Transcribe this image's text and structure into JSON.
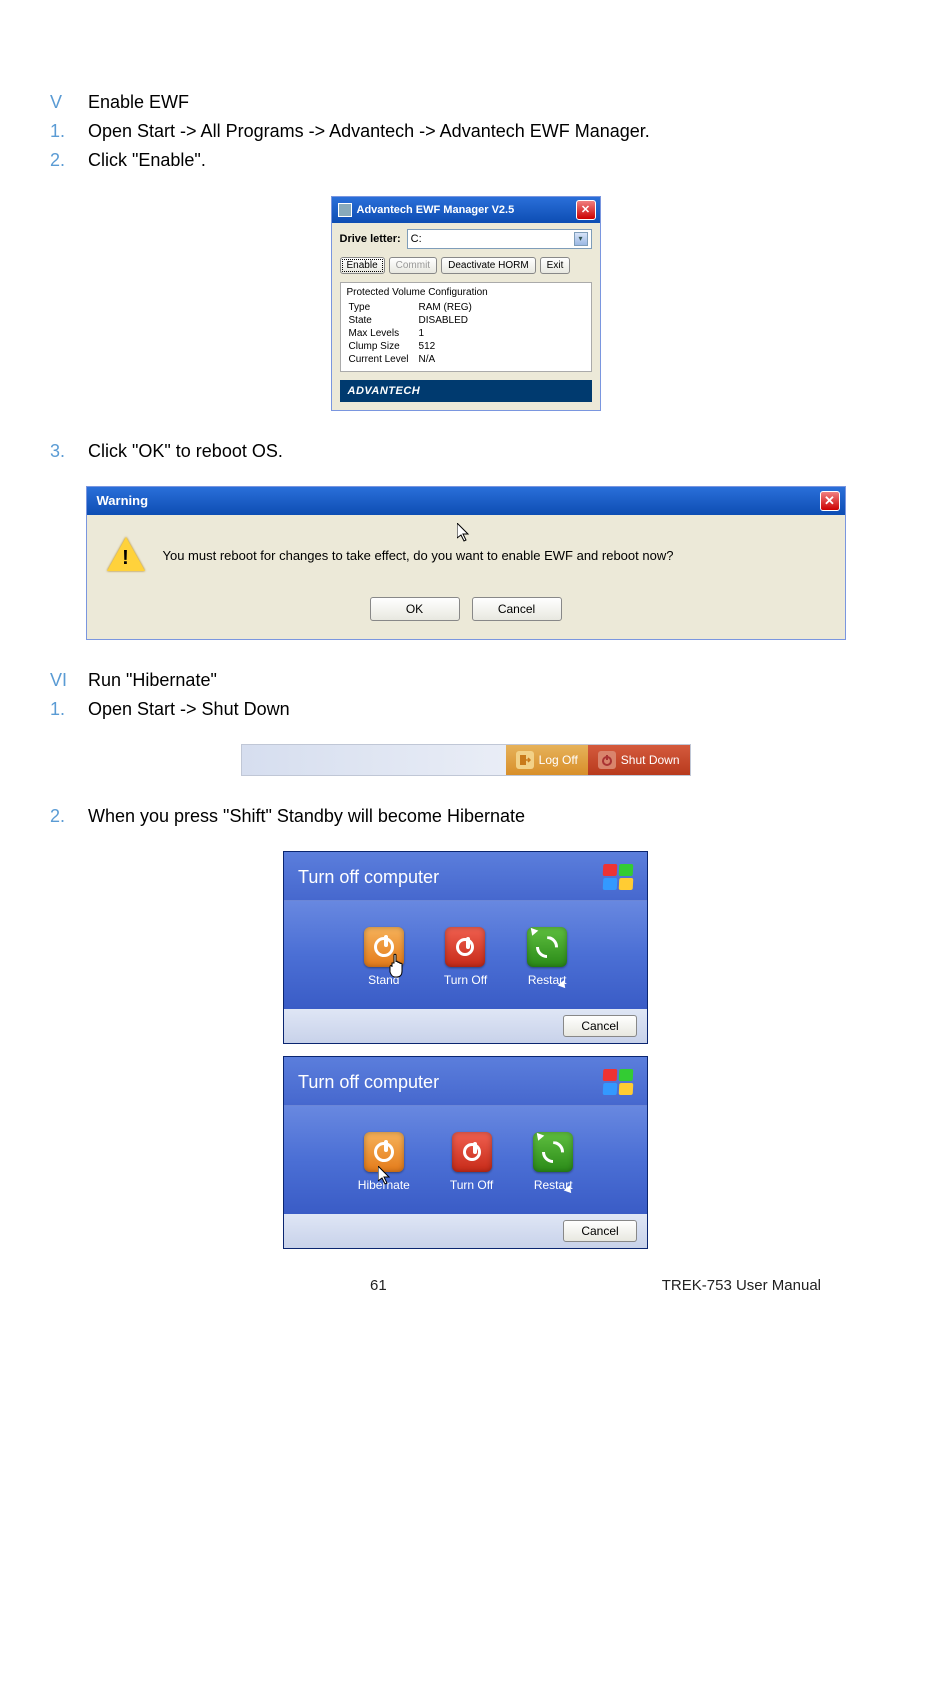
{
  "sectionV": {
    "numeral": "V",
    "title": "Enable EWF"
  },
  "stepsV": [
    {
      "n": "1.",
      "t": "Open Start -> All Programs -> Advantech -> Advantech EWF Manager."
    },
    {
      "n": "2.",
      "t": "Click \"Enable\"."
    }
  ],
  "ewf": {
    "windowTitle": "Advantech EWF Manager V2.5",
    "driveLabel": "Drive letter:",
    "driveValue": "C:",
    "btnEnable": "Enable",
    "btnCommit": "Commit",
    "btnDeact": "Deactivate HORM",
    "btnExit": "Exit",
    "configHeader": "Protected Volume Configuration",
    "rows": [
      [
        "Type",
        "RAM (REG)"
      ],
      [
        "State",
        "DISABLED"
      ],
      [
        "Max Levels",
        "1"
      ],
      [
        "Clump Size",
        "512"
      ],
      [
        "Current Level",
        "N/A"
      ]
    ],
    "logo": "ADVANTECH"
  },
  "step3": {
    "n": "3.",
    "t": "Click \"OK\" to reboot OS."
  },
  "warn": {
    "title": "Warning",
    "msg": "You must reboot for changes to take effect, do you want to enable EWF and reboot now?",
    "ok": "OK",
    "cancel": "Cancel"
  },
  "sectionVI": {
    "numeral": "VI",
    "title": "Run \"Hibernate\""
  },
  "stepsVI": [
    {
      "n": "1.",
      "t": "Open Start -> Shut Down"
    }
  ],
  "shutbar": {
    "logoff": "Log Off",
    "shutdown": "Shut Down"
  },
  "step2b": {
    "n": "2.",
    "t": "When you press \"Shift\" Standby will become Hibernate"
  },
  "toc1": {
    "title": "Turn off computer",
    "standby": "Stand",
    "turnoff": "Turn Off",
    "restart": "Restart",
    "cancel": "Cancel"
  },
  "toc2": {
    "title": "Turn off computer",
    "hibernate": "Hibernate",
    "turnoff": "Turn Off",
    "restart": "Restart",
    "cancel": "Cancel"
  },
  "footer": {
    "page": "61",
    "doc": "TREK-753 User Manual"
  }
}
